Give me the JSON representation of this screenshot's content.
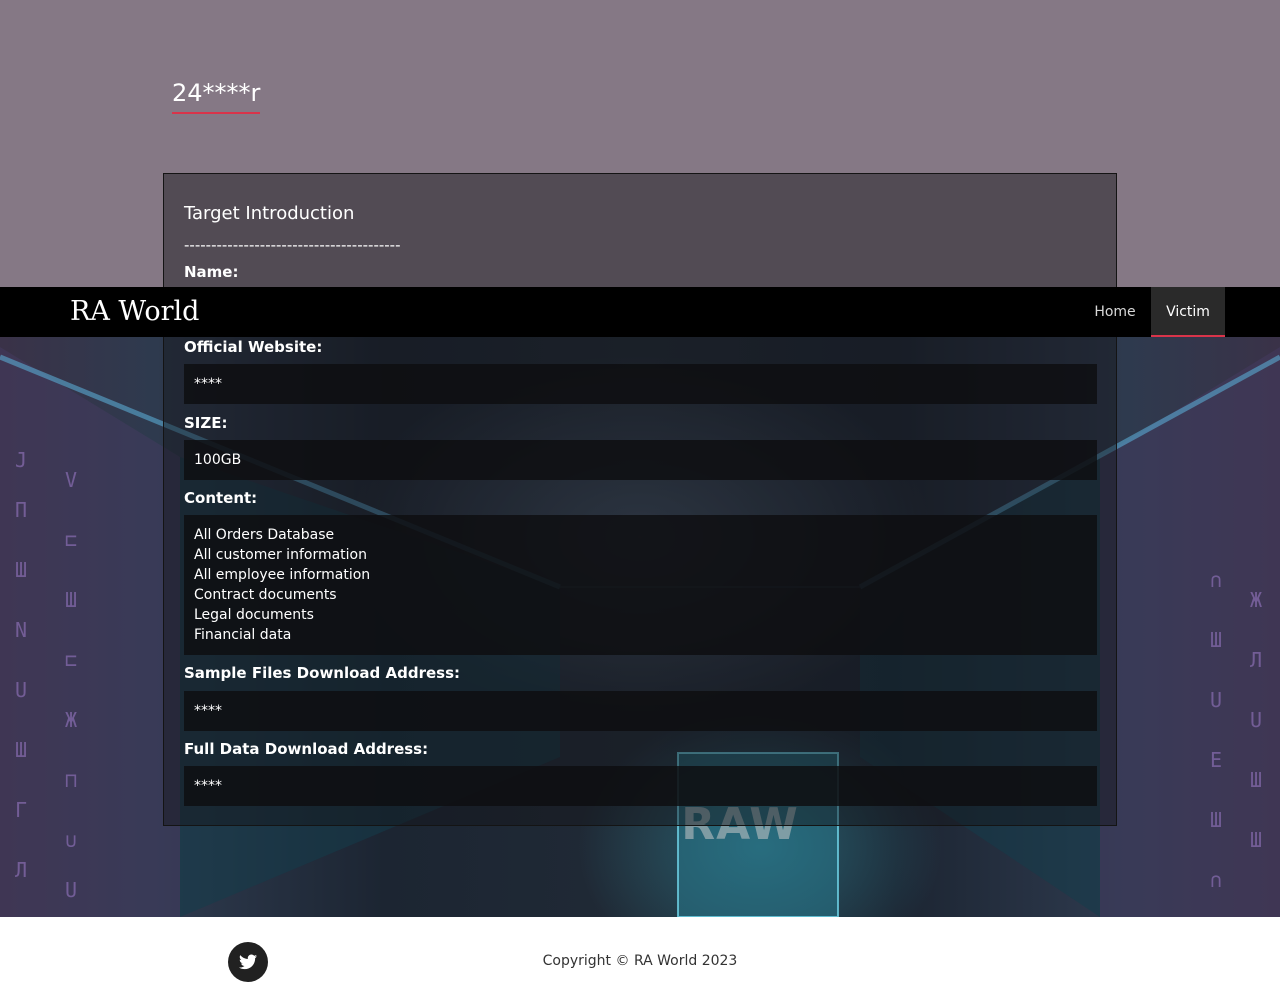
{
  "page": {
    "title": "24****r"
  },
  "navbar": {
    "brand": "RA World",
    "items": [
      {
        "label": "Home",
        "active": false
      },
      {
        "label": "Victim",
        "active": true
      }
    ],
    "accent_color": "#d9344a"
  },
  "panel": {
    "heading": "Target Introduction",
    "divider": "----------------------------------------",
    "fields": {
      "name": {
        "label": "Name:"
      },
      "website": {
        "label": "Official Website:",
        "value": "****"
      },
      "size": {
        "label": "SIZE:",
        "value": "100GB"
      },
      "content": {
        "label": "Content:",
        "items": [
          "All Orders Database",
          "All customer information",
          "All employee information",
          "Contract documents",
          "Legal documents",
          "Financial data"
        ]
      },
      "sample": {
        "label": "Sample Files Download Address:",
        "value": "****"
      },
      "full": {
        "label": "Full Data Download Address:",
        "value": "****"
      }
    }
  },
  "background": {
    "logo_text": "RAW"
  },
  "footer": {
    "social_icon": "twitter-icon",
    "copyright": "Copyright © RA World 2023"
  }
}
